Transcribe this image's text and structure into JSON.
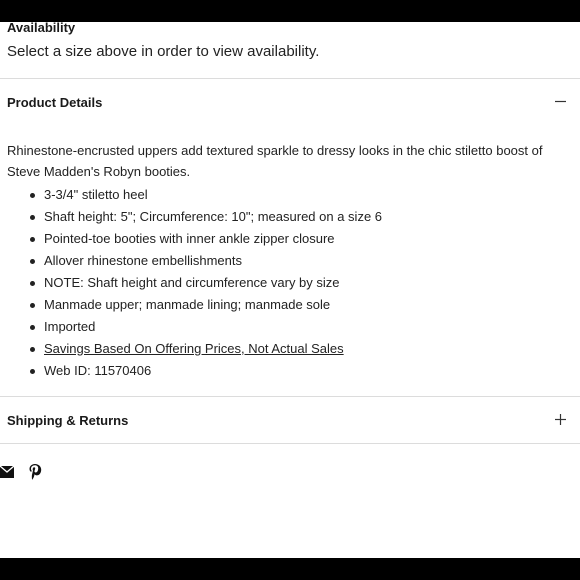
{
  "availability": {
    "heading": "Availability",
    "message": "Select a size above in order to view availability."
  },
  "product_details": {
    "title": "Product Details",
    "toggle_icon": "minus-icon",
    "description": "Rhinestone-encrusted uppers add textured sparkle to dressy looks in the chic stiletto boost of Steve Madden's Robyn booties.",
    "items": [
      "3-3/4\" stiletto heel",
      "Shaft height: 5\"; Circumference: 10\"; measured on a size 6",
      "Pointed-toe booties with inner ankle zipper closure",
      "Allover rhinestone embellishments",
      "NOTE: Shaft height and circumference vary by size",
      "Manmade upper; manmade lining; manmade sole",
      "Imported"
    ],
    "link_label": "Savings Based On Offering Prices, Not Actual Sales",
    "web_id": "Web ID: 11570406"
  },
  "shipping_returns": {
    "title": "Shipping & Returns",
    "toggle_icon": "plus-icon"
  },
  "share": {
    "email_icon": "envelope-icon",
    "pinterest_icon": "pinterest-icon"
  }
}
